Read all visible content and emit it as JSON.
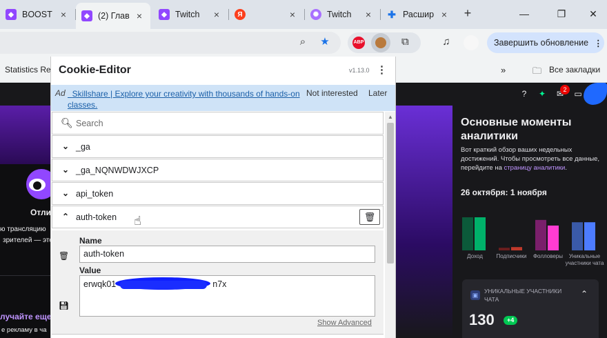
{
  "tabs": [
    {
      "label": "BOOST",
      "color": "#9147ff",
      "active": false
    },
    {
      "label": "(2) Глав",
      "color": "#9147ff",
      "active": true
    },
    {
      "label": "Twitch",
      "color": "#9147ff",
      "active": false
    },
    {
      "label": "",
      "color": "#fc3f1d",
      "active": false
    },
    {
      "label": "Twitch",
      "color": "#a970ff",
      "active": false
    },
    {
      "label": "Расшир",
      "color": "#1a73e8",
      "active": false
    }
  ],
  "toolbar": {
    "update_label": "Завершить обновление",
    "abp_label": "ABP"
  },
  "bookmarks": {
    "item": "Statistics Rep",
    "all": "Все закладки"
  },
  "twitch": {
    "left_title": "Отли",
    "left_line1": "ю трансляцию",
    "left_line2": "зрителей — это",
    "left_cta": "лучайте еще",
    "left_line3": "е рекламу в ча",
    "notif_count": "2",
    "insights_title": "Основные моменты аналитики",
    "insights_desc": "Вот краткий обзор ваших недельных достижений. Чтобы просмотреть все данные, перейдите на",
    "insights_link": "страницу аналитики",
    "insights_end": ".",
    "date_range": "26 октября: 1 ноября",
    "card_label": "УНИКАЛЬНЫЕ УЧАСТНИКИ ЧАТА",
    "card_value": "130",
    "card_delta": "+4"
  },
  "chart_data": {
    "type": "bar",
    "categories": [
      "Доход",
      "Подписчики",
      "Фолловеры",
      "Уникальные участники чата"
    ],
    "series": [
      {
        "values": [
          1.0,
          0.08,
          0.92,
          0.85
        ],
        "color_prev": [
          "#0b5a3a",
          "#6b1e1e",
          "#7a1f6b",
          "#3a5aa8"
        ]
      },
      {
        "values": [
          1.0,
          0.1,
          0.75,
          0.85
        ],
        "color_curr": [
          "#00b16a",
          "#c0392b",
          "#ff3cd2",
          "#4d7cff"
        ]
      }
    ]
  },
  "popup": {
    "title": "Cookie-Editor",
    "version": "v1.13.0",
    "ad_tag": "Ad",
    "ad_text": "Skillshare | Explore your creativity with thousands of hands-on classes.",
    "not_interested": "Not interested",
    "later": "Later",
    "search_placeholder": "Search",
    "cookies": [
      "_ga",
      "_ga_NQNWDWJXCP",
      "api_token",
      "auth-token"
    ],
    "edit": {
      "name_label": "Name",
      "name_value": "auth-token",
      "value_label": "Value",
      "value_prefix": "erwqk01",
      "value_suffix": "n7x",
      "show_advanced": "Show Advanced"
    }
  }
}
